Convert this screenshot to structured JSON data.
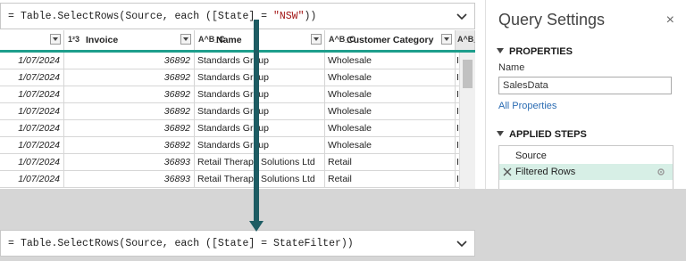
{
  "formula_top": {
    "eq": "=",
    "prefix": "Table.SelectRows(Source, ",
    "each": "each",
    "mid": " ([State] = ",
    "string": "\"NSW\"",
    "suffix": "))"
  },
  "formula_bottom": {
    "eq": "=",
    "prefix": "Table.SelectRows(Source, ",
    "each": "each",
    "mid": " ([State] = ",
    "param": "StateFilter",
    "suffix": "))"
  },
  "columns": {
    "invoice": {
      "type_icon": "1²3",
      "label": "Invoice"
    },
    "name": {
      "type_icon": "A^B_C",
      "label": "Name"
    },
    "category": {
      "type_icon": "A^B_C",
      "label": "Customer Category"
    },
    "extra": {
      "type_icon": "A^B_C"
    }
  },
  "rows": [
    {
      "date": "1/07/2024",
      "invoice": "36892",
      "name": "Standards Group",
      "category": "Wholesale",
      "extra": "I"
    },
    {
      "date": "1/07/2024",
      "invoice": "36892",
      "name": "Standards Group",
      "category": "Wholesale",
      "extra": "I"
    },
    {
      "date": "1/07/2024",
      "invoice": "36892",
      "name": "Standards Group",
      "category": "Wholesale",
      "extra": "I"
    },
    {
      "date": "1/07/2024",
      "invoice": "36892",
      "name": "Standards Group",
      "category": "Wholesale",
      "extra": "I"
    },
    {
      "date": "1/07/2024",
      "invoice": "36892",
      "name": "Standards Group",
      "category": "Wholesale",
      "extra": "I"
    },
    {
      "date": "1/07/2024",
      "invoice": "36892",
      "name": "Standards Group",
      "category": "Wholesale",
      "extra": "I"
    },
    {
      "date": "1/07/2024",
      "invoice": "36893",
      "name": "Retail Therapy Solutions Ltd",
      "category": "Retail",
      "extra": "I"
    },
    {
      "date": "1/07/2024",
      "invoice": "36893",
      "name": "Retail Therapy Solutions Ltd",
      "category": "Retail",
      "extra": "I"
    }
  ],
  "settings": {
    "title": "Query Settings",
    "close": "×",
    "properties": "PROPERTIES",
    "name_label": "Name",
    "name_value": "SalesData",
    "all_properties": "All Properties",
    "applied_steps": "APPLIED STEPS",
    "steps": [
      "Source",
      "Filtered Rows"
    ]
  },
  "colors": {
    "accent": "#1e9e8c",
    "arrow": "#1d5c63",
    "selected_step": "#d7efe6"
  }
}
